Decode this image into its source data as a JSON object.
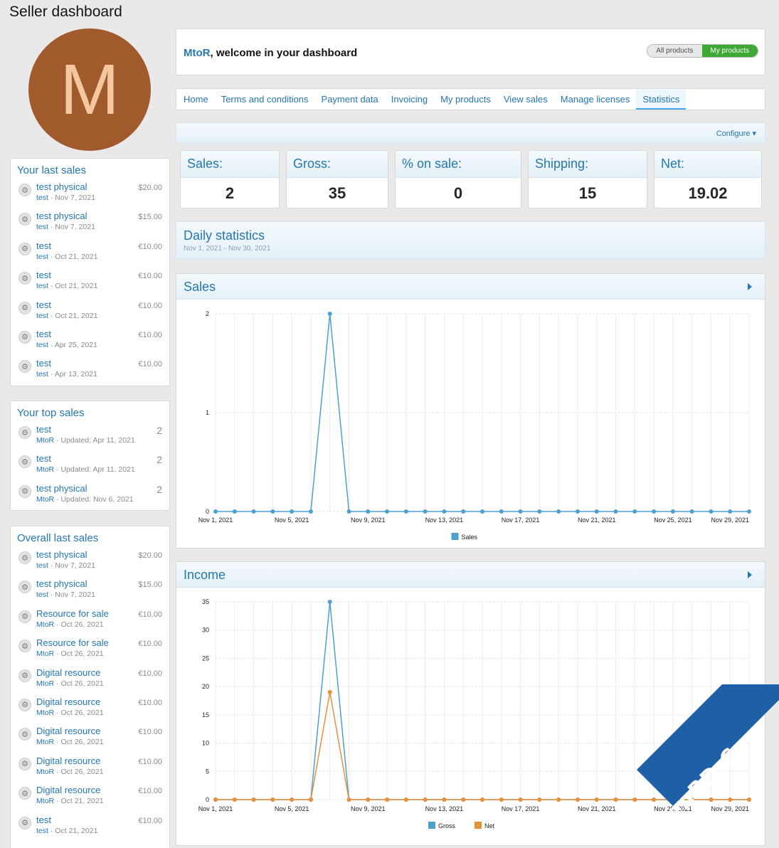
{
  "page": {
    "title": "Seller dashboard",
    "avatar_letter": "M"
  },
  "last_sales": {
    "title": "Your last sales",
    "items": [
      {
        "title": "test physical",
        "user": "test",
        "date": "Nov 7, 2021",
        "price": "$20.00"
      },
      {
        "title": "test physical",
        "user": "test",
        "date": "Nov 7, 2021",
        "price": "$15.00"
      },
      {
        "title": "test",
        "user": "test",
        "date": "Oct 21, 2021",
        "price": "€10.00"
      },
      {
        "title": "test",
        "user": "test",
        "date": "Oct 21, 2021",
        "price": "€10.00"
      },
      {
        "title": "test",
        "user": "test",
        "date": "Oct 21, 2021",
        "price": "€10.00"
      },
      {
        "title": "test",
        "user": "test",
        "date": "Apr 25, 2021",
        "price": "€10.00"
      },
      {
        "title": "test",
        "user": "test",
        "date": "Apr 13, 2021",
        "price": "€10.00"
      }
    ]
  },
  "top_sales": {
    "title": "Your top sales",
    "items": [
      {
        "title": "test",
        "user": "MtoR",
        "date": "Updated: Apr 11, 2021",
        "count": "2"
      },
      {
        "title": "test",
        "user": "MtoR",
        "date": "Updated: Apr 11, 2021",
        "count": "2"
      },
      {
        "title": "test physical",
        "user": "MtoR",
        "date": "Updated: Nov 6, 2021",
        "count": "2"
      }
    ]
  },
  "overall_sales": {
    "title": "Overall last sales",
    "items": [
      {
        "title": "test physical",
        "user": "test",
        "date": "Nov 7, 2021",
        "price": "$20.00"
      },
      {
        "title": "test physical",
        "user": "test",
        "date": "Nov 7, 2021",
        "price": "$15.00"
      },
      {
        "title": "Resource for sale",
        "user": "MtoR",
        "date": "Oct 26, 2021",
        "price": "€10.00"
      },
      {
        "title": "Resource for sale",
        "user": "MtoR",
        "date": "Oct 26, 2021",
        "price": "€10.00"
      },
      {
        "title": "Digital resource",
        "user": "MtoR",
        "date": "Oct 26, 2021",
        "price": "€10.00"
      },
      {
        "title": "Digital resource",
        "user": "MtoR",
        "date": "Oct 26, 2021",
        "price": "€10.00"
      },
      {
        "title": "Digital resource",
        "user": "MtoR",
        "date": "Oct 26, 2021",
        "price": "€10.00"
      },
      {
        "title": "Digital resource",
        "user": "MtoR",
        "date": "Oct 26, 2021",
        "price": "€10.00"
      },
      {
        "title": "Digital resource",
        "user": "MtoR",
        "date": "Oct 21, 2021",
        "price": "€10.00"
      },
      {
        "title": "test",
        "user": "test",
        "date": "Oct 21, 2021",
        "price": "€10.00"
      }
    ]
  },
  "welcome": {
    "user": "MtoR",
    "message": ", welcome in your dashboard",
    "toggle_all": "All products",
    "toggle_mine": "My products"
  },
  "tabs": [
    "Home",
    "Terms and conditions",
    "Payment data",
    "Invoicing",
    "My products",
    "View sales",
    "Manage licenses",
    "Statistics"
  ],
  "active_tab": "Statistics",
  "configure_label": "Configure ▾",
  "stats": [
    {
      "label": "Sales:",
      "value": "2"
    },
    {
      "label": "Gross:",
      "value": "35"
    },
    {
      "label": "% on sale:",
      "value": "0"
    },
    {
      "label": "Shipping:",
      "value": "15"
    },
    {
      "label": "Net:",
      "value": "19.02"
    }
  ],
  "daily": {
    "title": "Daily statistics",
    "range": "Nov 1, 2021 - Nov 30, 2021"
  },
  "watermark": "XenBD.Com",
  "colors": {
    "accent": "#2577b1",
    "sales": "#4ea0cf",
    "net": "#e8913a",
    "toggle_on": "#3ea834"
  },
  "chart_data": [
    {
      "type": "line",
      "title": "Sales",
      "x_tick_labels": [
        "Nov 1, 2021",
        "Nov 5, 2021",
        "Nov 9, 2021",
        "Nov 13, 2021",
        "Nov 17, 2021",
        "Nov 21, 2021",
        "Nov 25, 2021",
        "Nov 29, 2021"
      ],
      "x_day_range": [
        1,
        29
      ],
      "ylim": [
        0,
        2
      ],
      "y_ticks": [
        0,
        1,
        2
      ],
      "grid": true,
      "legend": "bottom",
      "series": [
        {
          "name": "Sales",
          "color": "#4ea0cf",
          "values": [
            0,
            0,
            0,
            0,
            0,
            0,
            2,
            0,
            0,
            0,
            0,
            0,
            0,
            0,
            0,
            0,
            0,
            0,
            0,
            0,
            0,
            0,
            0,
            0,
            0,
            0,
            0,
            0,
            0
          ]
        }
      ]
    },
    {
      "type": "line",
      "title": "Income",
      "x_tick_labels": [
        "Nov 1, 2021",
        "Nov 5, 2021",
        "Nov 9, 2021",
        "Nov 13, 2021",
        "Nov 17, 2021",
        "Nov 21, 2021",
        "Nov 25, 2021",
        "Nov 29, 2021"
      ],
      "x_day_range": [
        1,
        29
      ],
      "ylim": [
        0,
        35
      ],
      "y_ticks": [
        0,
        5,
        10,
        15,
        20,
        25,
        30,
        35
      ],
      "grid": true,
      "legend": "bottom",
      "series": [
        {
          "name": "Gross",
          "color": "#4ea0cf",
          "values": [
            0,
            0,
            0,
            0,
            0,
            0,
            35,
            0,
            0,
            0,
            0,
            0,
            0,
            0,
            0,
            0,
            0,
            0,
            0,
            0,
            0,
            0,
            0,
            0,
            0,
            0,
            0,
            0,
            0
          ]
        },
        {
          "name": "Net",
          "color": "#e8913a",
          "values": [
            0,
            0,
            0,
            0,
            0,
            0,
            19.02,
            0,
            0,
            0,
            0,
            0,
            0,
            0,
            0,
            0,
            0,
            0,
            0,
            0,
            0,
            0,
            0,
            0,
            0,
            0,
            0,
            0,
            0
          ]
        }
      ]
    }
  ]
}
